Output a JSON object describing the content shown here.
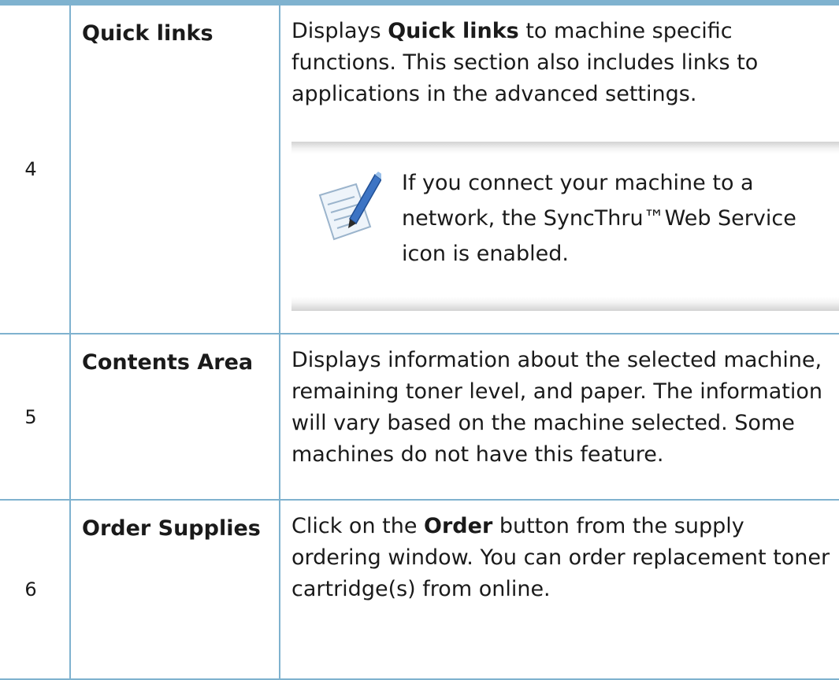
{
  "rows": [
    {
      "num": "4",
      "term": "Quick links",
      "desc_pre": "Displays ",
      "desc_bold": "Quick links",
      "desc_post": " to machine specific functions. This section also includes links to applications in the advanced settings.",
      "note": {
        "icon": "note-pencil-icon",
        "text": "If you connect your machine to a network, the SyncThru™Web Service icon is enabled."
      }
    },
    {
      "num": "5",
      "term": "Contents Area",
      "desc": "Displays information about the selected machine, remaining toner level, and paper. The information will vary based on the machine selected. Some machines do not have this feature."
    },
    {
      "num": "6",
      "term": "Order Supplies",
      "desc_pre": "Click on the ",
      "desc_bold": "Order",
      "desc_post": " button from the supply ordering window. You can order replacement toner cartridge(s) from online."
    }
  ],
  "colors": {
    "rule": "#7fb2cf",
    "note_band": "#d2d2d2"
  }
}
